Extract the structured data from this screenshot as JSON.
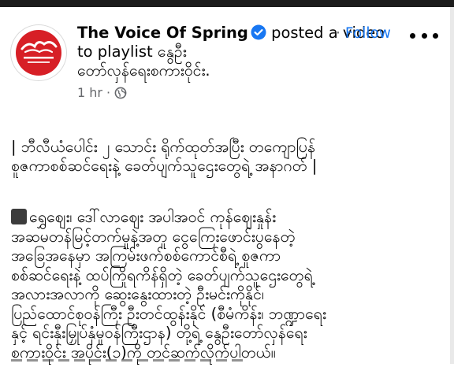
{
  "post": {
    "page_name": "The Voice Of Spring",
    "action_text": " posted a video to playlist နွေဦး",
    "playlist_line": "တော်လှန်ရေးစကားဝိုင်း.",
    "time": "1 hr",
    "follow_label": "Follow",
    "logo_text_top": "နွေဦး",
    "logo_text_bottom": "the voice of spring"
  },
  "content": {
    "paragraph1": "| ဘီလီယံပေါင်း ၂ သောင်း ရိုက်ထုတ်အပြီး တကျောပြန်\nစူဇကာစစ်ဆင်ရေးနဲ့ ခေတ်ပျက်သူဌေးတွေရဲ့ အနာဂတ် |",
    "paragraph2": "ရွှေဈေး၊ ဒေါ်လာဈေး အပါအဝင် ကုန်ဈေးနှုန်း\nအဆမတန်မြင့်တက်မှုနဲ့အတူ ငွေကြေးဖောင်းပွနေတဲ့\nအခြေအနေမှာ အကြမ်းဖက်စစ်ကောင်စီရဲ့ စူဇကာ\nစစ်ဆင်ရေးနဲ့ ထပ်ကြိုရကိန်ရှိတဲ့ ခေတ်ပျက်သူဌေးတွေရဲ့\nအလားအလာကို ဆွေးနွေးထားတဲ့ ဦးမင်းကိုနိုင်၊\nပြည်ထောင်စုဝန်ကြီး ဦးတင်ထွန်းနိုင် (စီမံကိန်း၊ ဘဏ္ဍာရေး\nနှင့် ရင်းနှီးမြှုပ်နှံမှုဝန်ကြီးဌာန) တို့ရဲ့ နွေဦးတော်လှန်ရေး\nစကားဝိုင်း အပိုင်း(၁)ကို တင်ဆက်လိုက်ပါတယ်။"
  },
  "colors": {
    "link_blue": "#1877f2",
    "verified_blue": "#1877f2",
    "meta_gray": "#65676b",
    "logo_red": "#d71f26"
  }
}
